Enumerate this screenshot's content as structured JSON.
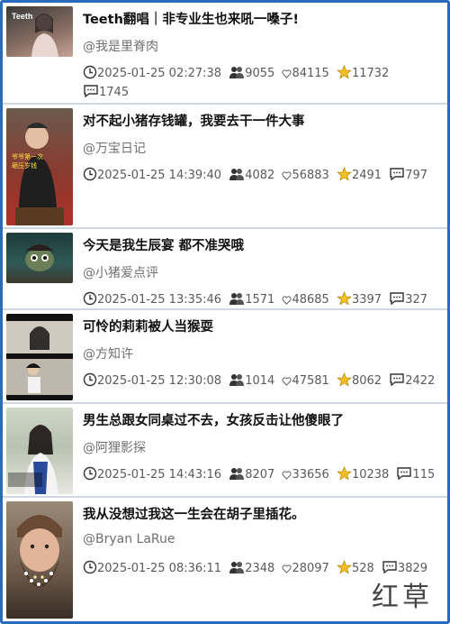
{
  "items": [
    {
      "title": "Teeth翻唱｜非专业生也来吼一嗓子!",
      "author": "@我是里脊肉",
      "time": "2025-01-25 02:27:38",
      "fans": "9055",
      "likes": "84115",
      "stars": "11732",
      "comments": "1745",
      "thumb_text": "Teeth"
    },
    {
      "title": "对不起小猪存钱罐，我要去干一件大事",
      "author": "@万宝日记",
      "time": "2025-01-25 14:39:40",
      "fans": "4082",
      "likes": "56883",
      "stars": "2491",
      "comments": "797",
      "thumb_text": "爷爷第一次\n砸压岁钱"
    },
    {
      "title": "今天是我生辰宴 都不准哭哦",
      "author": "@小猪爱点评",
      "time": "2025-01-25 13:35:46",
      "fans": "1571",
      "likes": "48685",
      "stars": "3397",
      "comments": "327"
    },
    {
      "title": "可怜的莉莉被人当猴耍",
      "author": "@方知许",
      "time": "2025-01-25 12:30:08",
      "fans": "1014",
      "likes": "47581",
      "stars": "8062",
      "comments": "2422"
    },
    {
      "title": "男生总跟女同桌过不去，女孩反击让他傻眼了",
      "author": "@阿狸影探",
      "time": "2025-01-25 14:43:16",
      "fans": "8207",
      "likes": "33656",
      "stars": "10238",
      "comments": "115"
    },
    {
      "title": "我从没想过我这一生会在胡子里插花。",
      "author": "@Bryan LaRue",
      "time": "2025-01-25 08:36:11",
      "fans": "2348",
      "likes": "28097",
      "stars": "528",
      "comments": "3829"
    }
  ],
  "watermark": "红草"
}
